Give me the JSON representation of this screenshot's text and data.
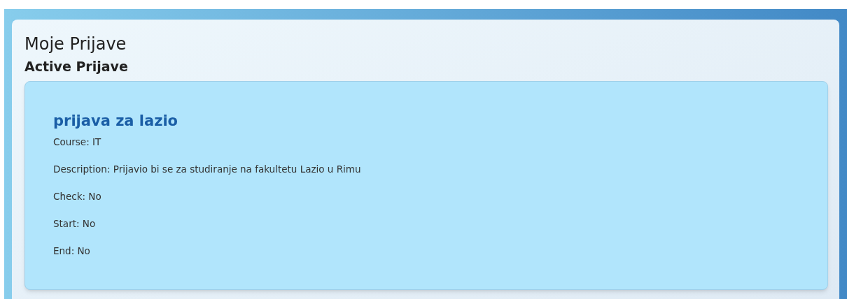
{
  "page_title": "Moje Prijave",
  "section_title": "Active Prijave",
  "applications": [
    {
      "title": "prijava za lazio",
      "fields": [
        "Course: IT",
        "Description: Prijavio bi se za studiranje na fakultetu Lazio u Rimu",
        "Check: No",
        "Start: No",
        "End: No"
      ]
    }
  ]
}
